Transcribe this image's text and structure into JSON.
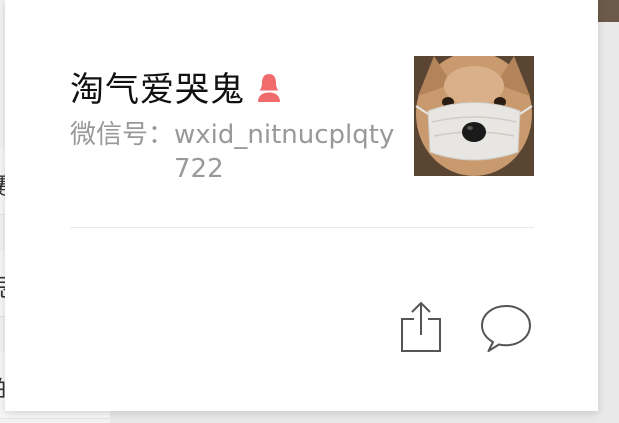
{
  "profile": {
    "nickname": "淘气爱哭鬼",
    "gender": "female",
    "wechat_id_label": "微信号：",
    "wechat_id": "wxid_nitnucplqty722"
  },
  "background_fragments": [
    "蹇",
    "思",
    "的"
  ],
  "colors": {
    "gender_icon": "#f06b6b",
    "icon_stroke": "#555555",
    "secondary_text": "#999999"
  },
  "icons": {
    "gender": "female-user-icon",
    "share": "share-icon",
    "message": "chat-bubble-icon"
  }
}
